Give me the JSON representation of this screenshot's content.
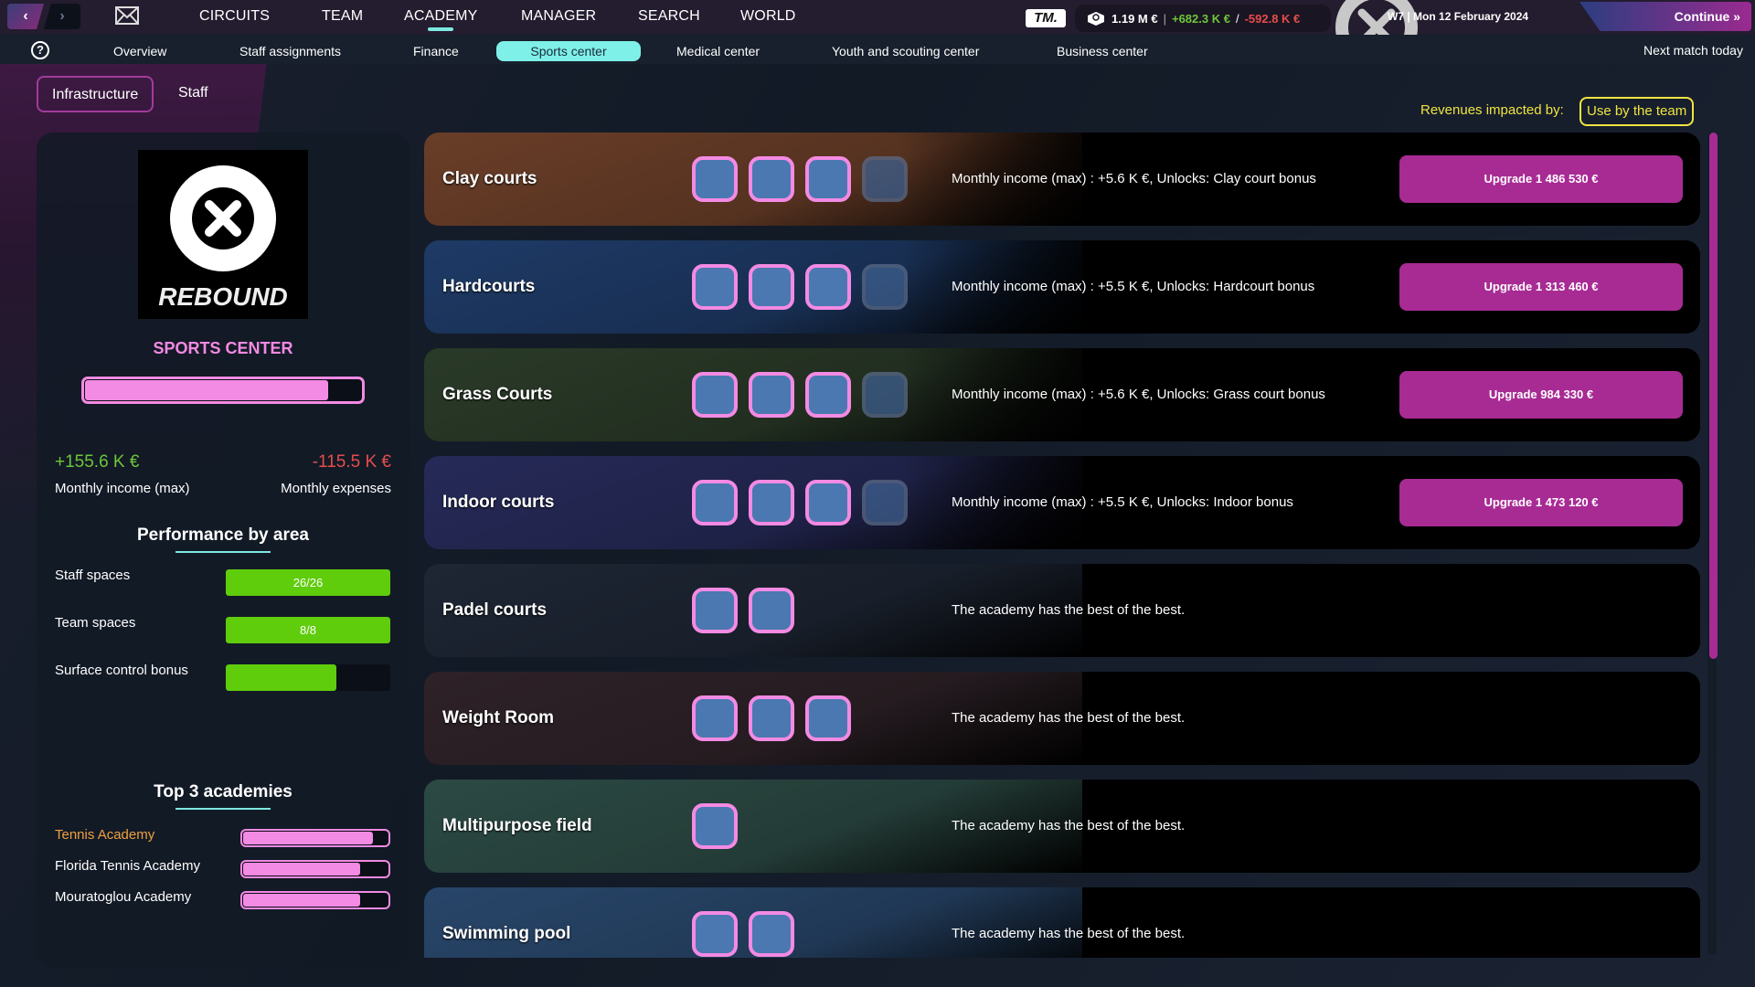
{
  "topbar": {
    "nav": [
      {
        "label": "CIRCUITS",
        "active": false
      },
      {
        "label": "TEAM",
        "active": false
      },
      {
        "label": "ACADEMY",
        "active": true
      },
      {
        "label": "MANAGER",
        "active": false
      },
      {
        "label": "SEARCH",
        "active": false
      },
      {
        "label": "WORLD",
        "active": false
      }
    ],
    "brand": "TM.",
    "balance": "1.19 M €",
    "income": "+682.3 K €",
    "expenses": "-592.8 K €",
    "sep1": "|",
    "sep2": "/",
    "date": "W7 | Mon 12 February 2024",
    "continue_label": "Continue »"
  },
  "subnav": {
    "items": [
      {
        "label": "Overview"
      },
      {
        "label": "Staff assignments"
      },
      {
        "label": "Finance"
      },
      {
        "label": "Sports center",
        "active": true
      },
      {
        "label": "Medical center"
      },
      {
        "label": "Youth and scouting center"
      },
      {
        "label": "Business center"
      }
    ],
    "next_match": "Next match today"
  },
  "tabs": [
    {
      "label": "Infrastructure",
      "active": true
    },
    {
      "label": "Staff"
    }
  ],
  "revenues": {
    "label": "Revenues impacted by:",
    "button": "Use by the team"
  },
  "left": {
    "logo_text": "REBOUND",
    "title": "SPORTS CENTER",
    "level_fraction": 0.88,
    "income_value": "+155.6 K €",
    "income_label": "Monthly income (max)",
    "expenses_value": "-115.5 K €",
    "expenses_label": "Monthly expenses",
    "performance_title": "Performance by area",
    "performance": [
      {
        "label": "Staff spaces",
        "text": "26/26",
        "fraction": 1.0
      },
      {
        "label": "Team spaces",
        "text": "8/8",
        "fraction": 1.0
      },
      {
        "label": "Surface control bonus",
        "text": "",
        "fraction": 0.67
      }
    ],
    "academies_title": "Top 3 academies",
    "academies": [
      {
        "label": "Tennis Academy",
        "fraction": 0.9,
        "highlight": "#f0a040"
      },
      {
        "label": "Florida Tennis Academy",
        "fraction": 0.81
      },
      {
        "label": "Mouratoglou Academy",
        "fraction": 0.81
      }
    ]
  },
  "facilities": [
    {
      "name": "Clay courts",
      "level": 3,
      "max": 4,
      "desc": "Monthly income (max) : +5.6 K €, Unlocks: Clay court bonus",
      "upgrade": "Upgrade 1 486 530 €",
      "bg": "#6a3e28"
    },
    {
      "name": "Hardcourts",
      "level": 3,
      "max": 4,
      "desc": "Monthly income (max) : +5.5 K €, Unlocks: Hardcourt bonus",
      "upgrade": "Upgrade 1 313 460 €",
      "bg": "#1e3a66"
    },
    {
      "name": "Grass Courts",
      "level": 3,
      "max": 4,
      "desc": "Monthly income (max) : +5.6 K €, Unlocks: Grass court bonus",
      "upgrade": "Upgrade 984 330 €",
      "bg": "#2a3a28"
    },
    {
      "name": "Indoor courts",
      "level": 3,
      "max": 4,
      "desc": "Monthly income (max) : +5.5 K €, Unlocks: Indoor bonus",
      "upgrade": "Upgrade 1 473 120 €",
      "bg": "#262a58"
    },
    {
      "name": "Padel courts",
      "level": 2,
      "max": 2,
      "desc": "The academy has the best of the best.",
      "upgrade": null,
      "bg": "#1e2634"
    },
    {
      "name": "Weight Room",
      "level": 3,
      "max": 3,
      "desc": "The academy has the best of the best.",
      "upgrade": null,
      "bg": "#2e2228"
    },
    {
      "name": "Multipurpose field",
      "level": 1,
      "max": 1,
      "desc": "The academy has the best of the best.",
      "upgrade": null,
      "bg": "#2c4a44"
    },
    {
      "name": "Swimming pool",
      "level": 2,
      "max": 2,
      "desc": "The academy has the best of the best.",
      "upgrade": null,
      "bg": "#28466a"
    }
  ],
  "scroll": {
    "visible_fraction": 0.64
  }
}
